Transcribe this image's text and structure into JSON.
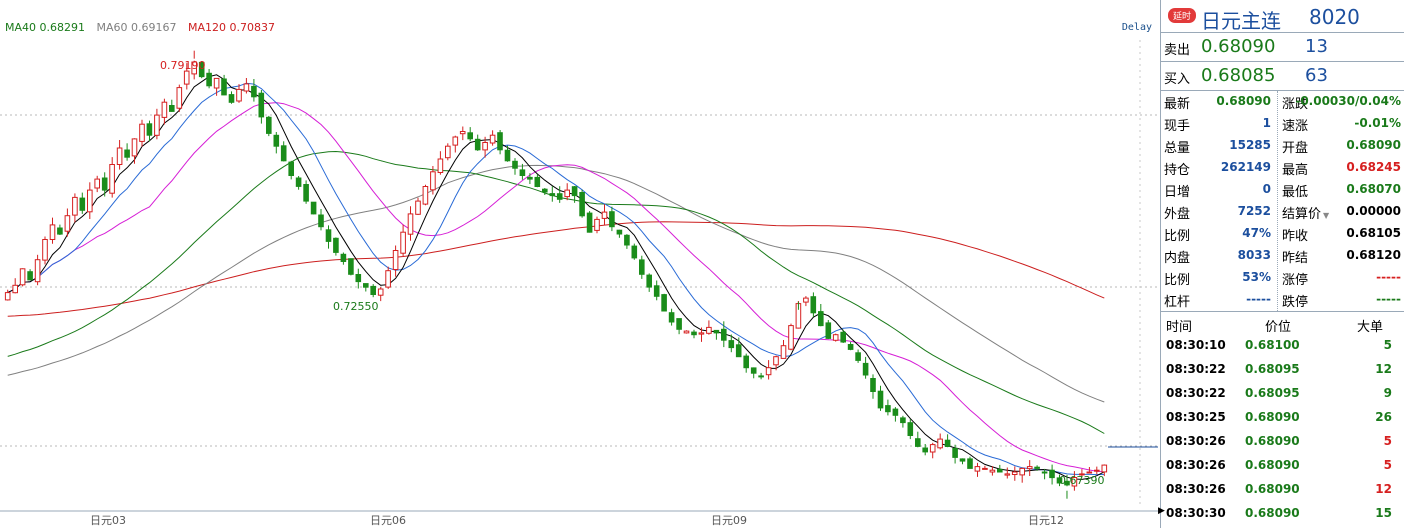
{
  "chart_data": {
    "type": "candlestick",
    "instrument": "日元主连",
    "y_range": [
      0.67,
      0.797
    ],
    "x_labels": [
      "日元03",
      "日元06",
      "日元09",
      "日元12"
    ],
    "ma_legend": [
      {
        "name": "MA40",
        "value": "0.68291",
        "color": "#1a7a1a"
      },
      {
        "name": "MA60",
        "value": "0.69167",
        "color": "#808080"
      },
      {
        "name": "MA120",
        "value": "0.70837",
        "color": "#cc1f1f"
      }
    ],
    "delay_label": "Delay",
    "annotations": [
      {
        "text": "0.79190",
        "value": 0.7919,
        "kind": "high"
      },
      {
        "text": "0.72550",
        "value": 0.7255,
        "kind": "low"
      },
      {
        "text": "0.67390",
        "value": 0.6739,
        "kind": "low"
      }
    ],
    "colors": {
      "up": "#d62020",
      "down": "#1a8c1a",
      "ma5": "#000000",
      "ma10": "#2a6bd6",
      "ma20": "#d61fd6",
      "ma40": "#1a7a1a",
      "ma60": "#808080",
      "ma120": "#cc1f1f"
    },
    "close_series": [
      0.728,
      0.73,
      0.7345,
      0.7315,
      0.737,
      0.7425,
      0.7465,
      0.744,
      0.749,
      0.754,
      0.7505,
      0.756,
      0.759,
      0.756,
      0.763,
      0.7675,
      0.765,
      0.77,
      0.774,
      0.771,
      0.7765,
      0.78,
      0.7775,
      0.784,
      0.7885,
      0.791,
      0.787,
      0.7845,
      0.7865,
      0.782,
      0.78,
      0.7835,
      0.785,
      0.7815,
      0.776,
      0.7715,
      0.768,
      0.764,
      0.76,
      0.757,
      0.753,
      0.7495,
      0.746,
      0.742,
      0.739,
      0.7365,
      0.733,
      0.731,
      0.7295,
      0.7275,
      0.729,
      0.734,
      0.7395,
      0.7445,
      0.7495,
      0.753,
      0.757,
      0.761,
      0.7645,
      0.768,
      0.7705,
      0.772,
      0.77,
      0.767,
      0.769,
      0.771,
      0.767,
      0.764,
      0.762,
      0.76,
      0.759,
      0.757,
      0.7555,
      0.7545,
      0.7535,
      0.756,
      0.7545,
      0.749,
      0.7445,
      0.748,
      0.75,
      0.746,
      0.744,
      0.741,
      0.7375,
      0.733,
      0.7295,
      0.727,
      0.723,
      0.72,
      0.718,
      0.7175,
      0.7165,
      0.717,
      0.7185,
      0.717,
      0.715,
      0.713,
      0.7105,
      0.7075,
      0.706,
      0.705,
      0.7075,
      0.7105,
      0.7135,
      0.719,
      0.725,
      0.7265,
      0.7225,
      0.719,
      0.7155,
      0.7165,
      0.7145,
      0.7125,
      0.7095,
      0.7055,
      0.701,
      0.6965,
      0.6955,
      0.6945,
      0.6925,
      0.689,
      0.686,
      0.6845,
      0.6865,
      0.688,
      0.686,
      0.683,
      0.682,
      0.68,
      0.6805,
      0.68,
      0.6795,
      0.679,
      0.6785,
      0.679,
      0.68,
      0.6805,
      0.68,
      0.679,
      0.6775,
      0.676,
      0.6755,
      0.6775,
      0.6785,
      0.679,
      0.6795,
      0.6809
    ]
  },
  "quote": {
    "badge": "延时",
    "name": "日元主连",
    "code": "8020",
    "ask": {
      "label": "卖出",
      "price": "0.68090",
      "volume": "13"
    },
    "bid": {
      "label": "买入",
      "price": "0.68085",
      "volume": "63"
    },
    "stats": [
      {
        "l1": "最新",
        "v1": "0.68090",
        "c1": "#1a7a1a",
        "l2": "涨跌",
        "v2": "-0.00030/0.04%",
        "c2": "#1a7a1a"
      },
      {
        "l1": "现手",
        "v1": "1",
        "c1": "#1c4f9e",
        "l2": "速涨",
        "v2": "-0.01%",
        "c2": "#1a7a1a"
      },
      {
        "l1": "总量",
        "v1": "15285",
        "c1": "#1c4f9e",
        "l2": "开盘",
        "v2": "0.68090",
        "c2": "#1a7a1a"
      },
      {
        "l1": "持仓",
        "v1": "262149",
        "c1": "#1c4f9e",
        "l2": "最高",
        "v2": "0.68245",
        "c2": "#d62020"
      },
      {
        "l1": "日增",
        "v1": "0",
        "c1": "#1c4f9e",
        "l2": "最低",
        "v2": "0.68070",
        "c2": "#1a7a1a"
      },
      {
        "l1": "外盘",
        "v1": "7252",
        "c1": "#1c4f9e",
        "l2": "结算价",
        "v2": "0.00000",
        "c2": "#000000"
      },
      {
        "l1": "比例",
        "v1": "47%",
        "c1": "#1c4f9e",
        "l2": "昨收",
        "v2": "0.68105",
        "c2": "#000000"
      },
      {
        "l1": "内盘",
        "v1": "8033",
        "c1": "#1c4f9e",
        "l2": "昨结",
        "v2": "0.68120",
        "c2": "#000000"
      },
      {
        "l1": "比例",
        "v1": "53%",
        "c1": "#1c4f9e",
        "l2": "涨停",
        "v2": "-----",
        "c2": "#d62020"
      },
      {
        "l1": "杠杆",
        "v1": "-----",
        "c1": "#1c4f9e",
        "l2": "跌停",
        "v2": "-----",
        "c2": "#1a7a1a"
      }
    ],
    "trades_header": {
      "time": "时间",
      "price": "价位",
      "volume": "大单"
    },
    "trades": [
      {
        "time": "08:30:10",
        "price": "0.68100",
        "volume": "5",
        "vcolor": "#1a7a1a"
      },
      {
        "time": "08:30:22",
        "price": "0.68095",
        "volume": "12",
        "vcolor": "#1a7a1a"
      },
      {
        "time": "08:30:22",
        "price": "0.68095",
        "volume": "9",
        "vcolor": "#1a7a1a"
      },
      {
        "time": "08:30:25",
        "price": "0.68090",
        "volume": "26",
        "vcolor": "#1a7a1a"
      },
      {
        "time": "08:30:26",
        "price": "0.68090",
        "volume": "5",
        "vcolor": "#d62020"
      },
      {
        "time": "08:30:26",
        "price": "0.68090",
        "volume": "5",
        "vcolor": "#d62020"
      },
      {
        "time": "08:30:26",
        "price": "0.68090",
        "volume": "12",
        "vcolor": "#d62020"
      },
      {
        "time": "08:30:30",
        "price": "0.68090",
        "volume": "15",
        "vcolor": "#1a7a1a"
      }
    ]
  }
}
